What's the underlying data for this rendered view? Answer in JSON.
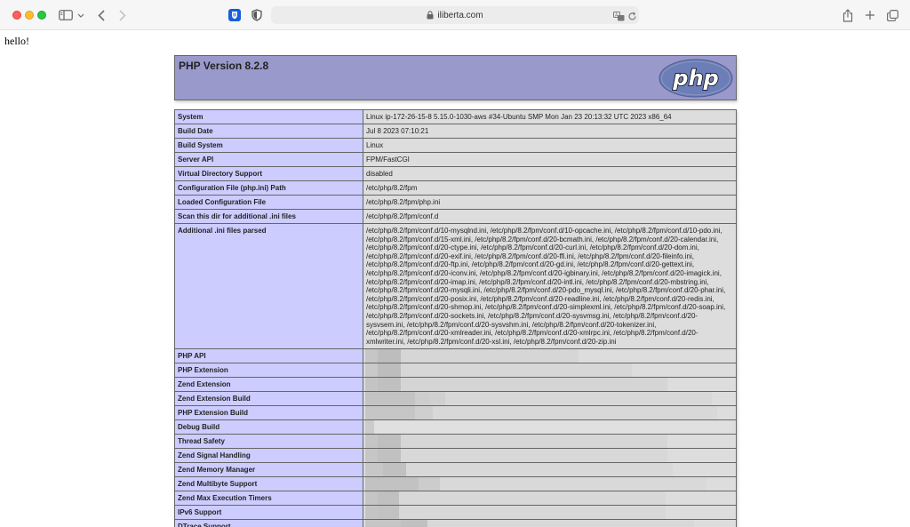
{
  "browser": {
    "url": "iliberta.com",
    "icons": {
      "sidebar": "sidebar-toggle-icon",
      "back": "chevron-left-icon",
      "forward": "chevron-right-icon",
      "extension1": "bitwarden-shield-icon",
      "extension2": "privacy-shield-icon",
      "translate": "translate-icon",
      "reload": "reload-icon",
      "share": "share-icon",
      "new_tab": "plus-icon",
      "tab_overview": "tab-overview-icon"
    }
  },
  "page": {
    "hello": "hello!",
    "php_version_title": "PHP Version 8.2.8",
    "logo_text": "php",
    "colors": {
      "header_bg": "#9999cc",
      "label_bg": "#ccccff",
      "value_bg": "#dddddd"
    }
  },
  "table": {
    "rows": [
      {
        "label": "System",
        "value": "Linux ip-172-26-15-8 5.15.0-1030-aws #34-Ubuntu SMP Mon Jan 23 20:13:32 UTC 2023 x86_64"
      },
      {
        "label": "Build Date",
        "value": "Jul 8 2023 07:10:21"
      },
      {
        "label": "Build System",
        "value": "Linux"
      },
      {
        "label": "Server API",
        "value": "FPM/FastCGI"
      },
      {
        "label": "Virtual Directory Support",
        "value": "disabled"
      },
      {
        "label": "Configuration File (php.ini) Path",
        "value": "/etc/php/8.2/fpm"
      },
      {
        "label": "Loaded Configuration File",
        "value": "/etc/php/8.2/fpm/php.ini"
      },
      {
        "label": "Scan this dir for additional .ini files",
        "value": "/etc/php/8.2/fpm/conf.d"
      },
      {
        "label": "Additional .ini files parsed",
        "value": "/etc/php/8.2/fpm/conf.d/10-mysqlnd.ini, /etc/php/8.2/fpm/conf.d/10-opcache.ini, /etc/php/8.2/fpm/conf.d/10-pdo.ini, /etc/php/8.2/fpm/conf.d/15-xml.ini, /etc/php/8.2/fpm/conf.d/20-bcmath.ini, /etc/php/8.2/fpm/conf.d/20-calendar.ini, /etc/php/8.2/fpm/conf.d/20-ctype.ini, /etc/php/8.2/fpm/conf.d/20-curl.ini, /etc/php/8.2/fpm/conf.d/20-dom.ini, /etc/php/8.2/fpm/conf.d/20-exif.ini, /etc/php/8.2/fpm/conf.d/20-ffi.ini, /etc/php/8.2/fpm/conf.d/20-fileinfo.ini, /etc/php/8.2/fpm/conf.d/20-ftp.ini, /etc/php/8.2/fpm/conf.d/20-gd.ini, /etc/php/8.2/fpm/conf.d/20-gettext.ini, /etc/php/8.2/fpm/conf.d/20-iconv.ini, /etc/php/8.2/fpm/conf.d/20-igbinary.ini, /etc/php/8.2/fpm/conf.d/20-imagick.ini, /etc/php/8.2/fpm/conf.d/20-imap.ini, /etc/php/8.2/fpm/conf.d/20-intl.ini, /etc/php/8.2/fpm/conf.d/20-mbstring.ini, /etc/php/8.2/fpm/conf.d/20-mysqli.ini, /etc/php/8.2/fpm/conf.d/20-pdo_mysql.ini, /etc/php/8.2/fpm/conf.d/20-phar.ini, /etc/php/8.2/fpm/conf.d/20-posix.ini, /etc/php/8.2/fpm/conf.d/20-readline.ini, /etc/php/8.2/fpm/conf.d/20-redis.ini, /etc/php/8.2/fpm/conf.d/20-shmop.ini, /etc/php/8.2/fpm/conf.d/20-simplexml.ini, /etc/php/8.2/fpm/conf.d/20-soap.ini, /etc/php/8.2/fpm/conf.d/20-sockets.ini, /etc/php/8.2/fpm/conf.d/20-sysvmsg.ini, /etc/php/8.2/fpm/conf.d/20-sysvsem.ini, /etc/php/8.2/fpm/conf.d/20-sysvshm.ini, /etc/php/8.2/fpm/conf.d/20-tokenizer.ini, /etc/php/8.2/fpm/conf.d/20-xmlreader.ini, /etc/php/8.2/fpm/conf.d/20-xmlrpc.ini, /etc/php/8.2/fpm/conf.d/20-xmlwriter.ini, /etc/php/8.2/fpm/conf.d/20-xsl.ini, /etc/php/8.2/fpm/conf.d/20-zip.ini"
      }
    ],
    "obscured_rows": [
      "PHP API",
      "PHP Extension",
      "Zend Extension",
      "Zend Extension Build",
      "PHP Extension Build",
      "Debug Build",
      "Thread Safety",
      "Zend Signal Handling",
      "Zend Memory Manager",
      "Zend Multibyte Support",
      "Zend Max Execution Timers",
      "IPv6 Support",
      "DTrace Support"
    ]
  }
}
